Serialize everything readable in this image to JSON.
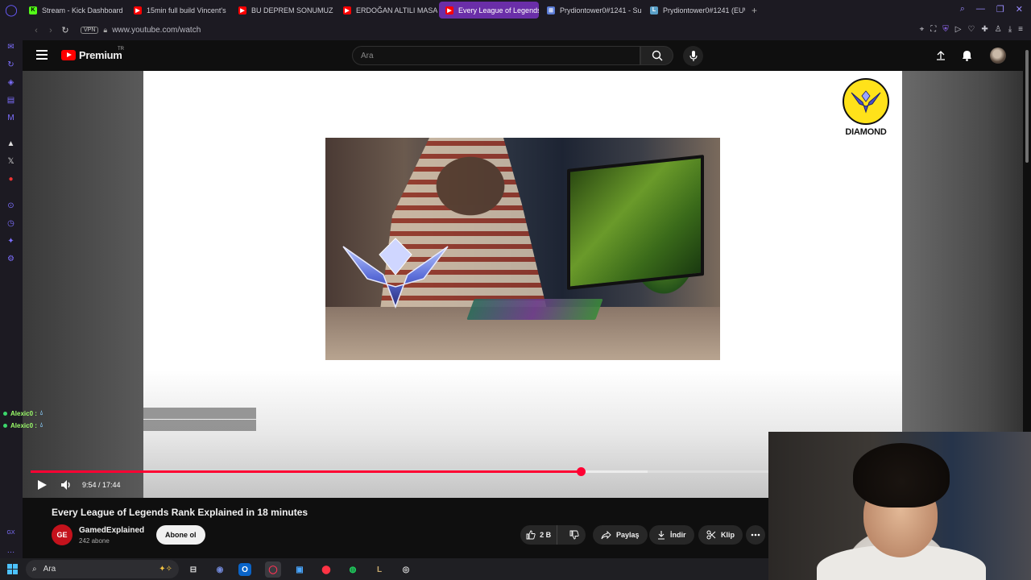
{
  "browser": {
    "tabs": [
      {
        "label": "Stream - Kick Dashboard",
        "fav_color": "#53fc18",
        "fav_text": "K"
      },
      {
        "label": "15min full build Vincent's",
        "fav_color": "#ff0000",
        "fav_text": "▶"
      },
      {
        "label": "BU DEPREM SONUMUZ O",
        "fav_color": "#ff0000",
        "fav_text": "▶"
      },
      {
        "label": "ERDOĞAN ALTILI MASA",
        "fav_color": "#ff0000",
        "fav_text": "▶"
      },
      {
        "label": "Every League of Legends",
        "fav_color": "#ff0000",
        "fav_text": "▶",
        "active": true
      },
      {
        "label": "Prydiontower0#1241 - Su",
        "fav_color": "#5a7bd6",
        "fav_text": "⊞"
      },
      {
        "label": "Prydiontower0#1241 (EUW",
        "fav_color": "#5aa0c8",
        "fav_text": "L"
      }
    ],
    "address": "www.youtube.com/watch",
    "vpn_label": "VPN"
  },
  "youtube": {
    "brand": "Premium",
    "region": "TR",
    "search_placeholder": "Ara"
  },
  "video": {
    "badge_label": "DIAMOND",
    "current_time": "9:54",
    "duration": "17:44",
    "time_display": "9:54 / 17:44",
    "progress_fraction": 0.746,
    "buffer_fraction": 0.836
  },
  "chat": [
    {
      "user": "Alexic0 :"
    },
    {
      "user": "Alexic0 :"
    }
  ],
  "info": {
    "title": "Every League of Legends Rank Explained in 18 minutes",
    "channel": "GamedExplained",
    "channel_initials": "GE",
    "subscribers": "242 abone",
    "subscribe_label": "Abone ol",
    "likes": "2 B",
    "share_label": "Paylaş",
    "download_label": "İndir",
    "clip_label": "Klip"
  },
  "taskbar": {
    "search_placeholder": "Ara"
  },
  "colors": {
    "accent_red": "#ff0033",
    "opera_purple": "#6a2ea8",
    "badge_yellow": "#ffe21a"
  }
}
